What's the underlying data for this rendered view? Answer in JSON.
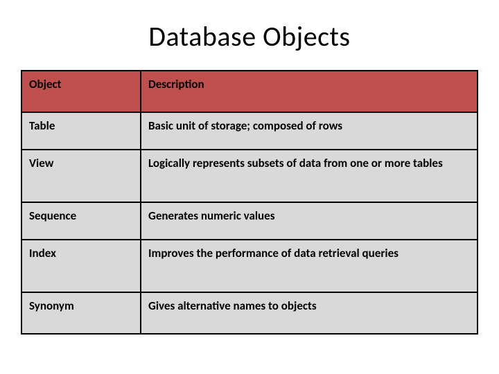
{
  "title": "Database Objects",
  "headers": {
    "object": "Object",
    "description": "Description"
  },
  "rows": [
    {
      "object": "Table",
      "description": "Basic unit of storage; composed of rows"
    },
    {
      "object": "View",
      "description": "Logically represents subsets of data from one or more tables"
    },
    {
      "object": "Sequence",
      "description": "Generates numeric values"
    },
    {
      "object": "Index",
      "description": "Improves the performance of data retrieval queries"
    },
    {
      "object": "Synonym",
      "description": "Gives alternative names to objects"
    }
  ]
}
